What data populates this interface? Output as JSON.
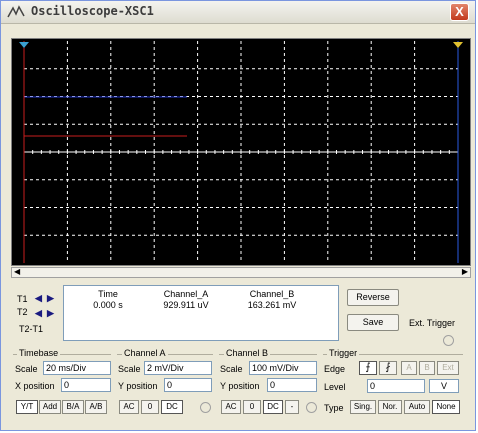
{
  "window": {
    "title": "Oscilloscope-XSC1",
    "close_label": "X"
  },
  "display": {
    "background": "#000000",
    "grid_color": "#ffffff",
    "channel_a_color": "#c81e1e",
    "channel_b_color": "#1e32c8"
  },
  "cursors": {
    "t1_label": "T1",
    "t2_label": "T2",
    "diff_label": "T2-T1",
    "left_arrow": "◀",
    "right_arrow": "▶",
    "headers": {
      "time": "Time",
      "channel_a": "Channel_A",
      "channel_b": "Channel_B"
    },
    "row1": {
      "time": "0.000 s",
      "channel_a": "929.911 uV",
      "channel_b": "163.261 mV"
    }
  },
  "buttons": {
    "reverse": "Reverse",
    "save": "Save",
    "ext_trigger": "Ext. Trigger"
  },
  "timebase": {
    "title": "Timebase",
    "scale_label": "Scale",
    "scale_value": "20 ms/Div",
    "xpos_label": "X position",
    "xpos_value": "0",
    "modes": [
      "Y/T",
      "Add",
      "B/A",
      "A/B"
    ]
  },
  "channel_a": {
    "title": "Channel A",
    "scale_label": "Scale",
    "scale_value": "2 mV/Div",
    "ypos_label": "Y position",
    "ypos_value": "0",
    "coupling": [
      "AC",
      "0",
      "DC"
    ]
  },
  "channel_b": {
    "title": "Channel B",
    "scale_label": "Scale",
    "scale_value": "100 mV/Div",
    "ypos_label": "Y position",
    "ypos_value": "0",
    "coupling": [
      "AC",
      "0",
      "DC",
      "-"
    ]
  },
  "trigger": {
    "title": "Trigger",
    "edge_label": "Edge",
    "edge_rise": "⨍",
    "edge_fall": "⨏",
    "sources": [
      "A",
      "B",
      "Ext"
    ],
    "level_label": "Level",
    "level_value": "0",
    "level_unit": "V",
    "type_label": "Type",
    "types": [
      "Sing.",
      "Nor.",
      "Auto",
      "None"
    ]
  }
}
